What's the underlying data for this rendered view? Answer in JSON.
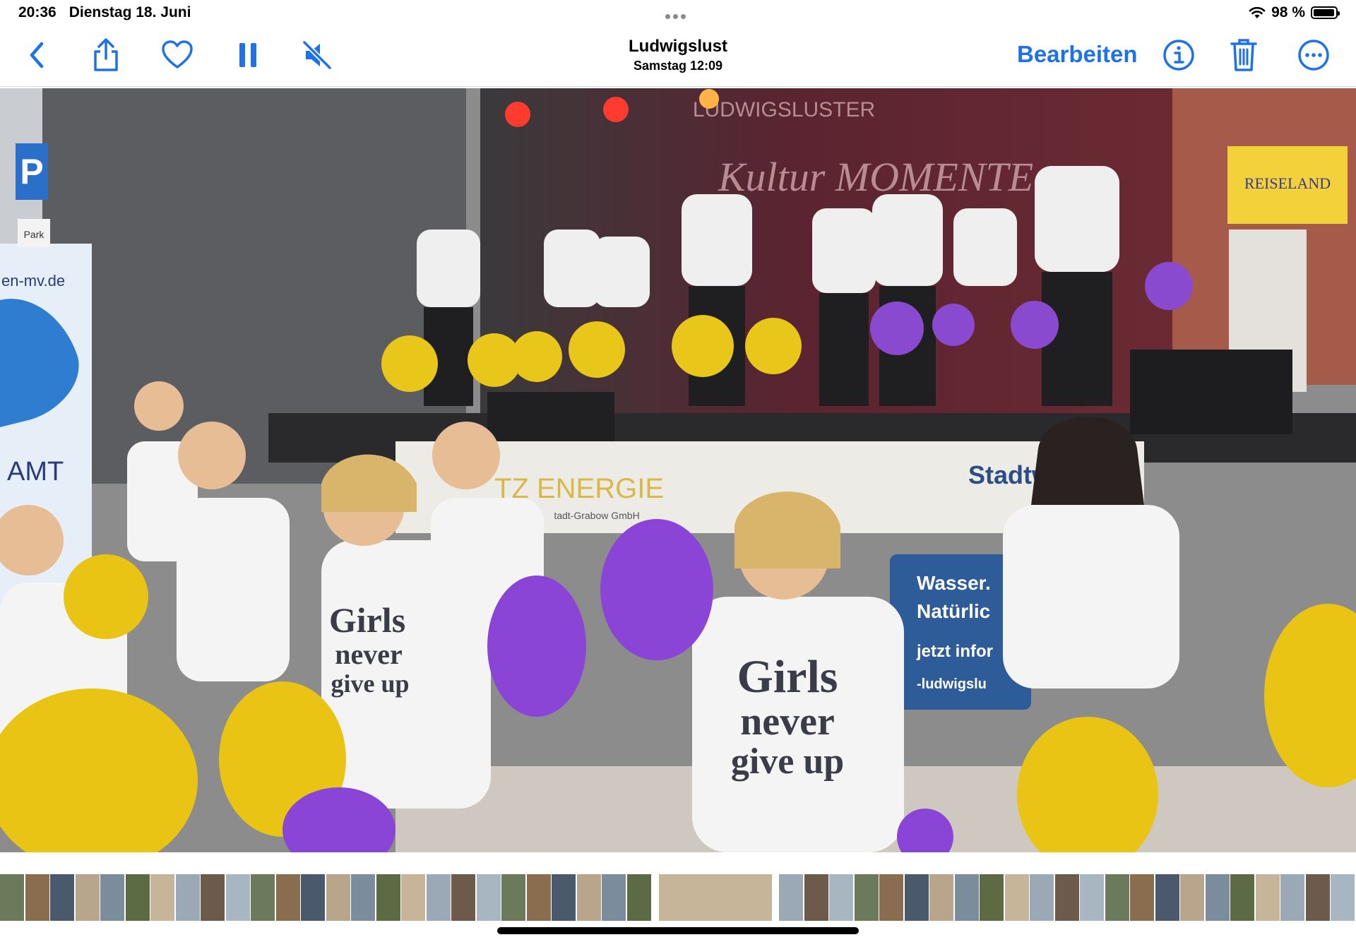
{
  "status_bar": {
    "time": "20:36",
    "date": "Dienstag 18. Juni",
    "battery_text": "98 %",
    "battery_level": 0.98
  },
  "toolbar": {
    "title": "Ludwigslust",
    "subtitle": "Samstag  12:09",
    "edit_label": "Bearbeiten",
    "accent": "#1e72e8",
    "icons": [
      "back-chevron-icon",
      "share-icon",
      "heart-icon",
      "pause-icon",
      "speaker-muted-icon",
      "info-icon",
      "trash-icon",
      "more-icon"
    ]
  },
  "photo": {
    "description_text": {
      "banner_energie": "TZ ENERGIE",
      "banner_energie_sub": "tadt-Grabow GmbH",
      "banner_stadtw": "Stadtw",
      "banner_wasser_1": "Wasser.",
      "banner_wasser_2": "Natürlic",
      "banner_wasser_3": "jetzt infor",
      "banner_wasser_4": "-ludwigslu",
      "stage_backdrop_1": "LUDWIGSLUSTER",
      "stage_backdrop_2": "Kultur MOMENTE",
      "shop_sign": "REISELAND",
      "left_banner_url": "en-mv.de",
      "left_banner_2": "AMT",
      "parking_sign": "P",
      "parking_sub": "Park",
      "shirt_text_1": "Girls",
      "shirt_text_2": "never",
      "shirt_text_3": "give up"
    }
  },
  "filmstrip": {
    "count": 54,
    "current_index": 26
  }
}
